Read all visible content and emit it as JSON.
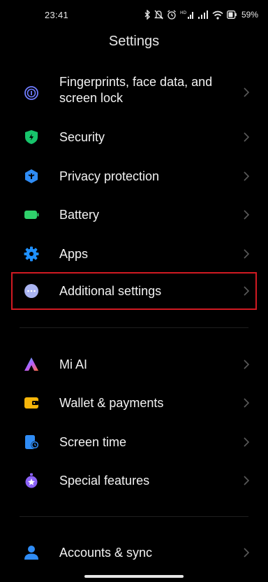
{
  "status_bar": {
    "time": "23:41",
    "battery_percent": "59%",
    "icons": [
      "bluetooth-icon",
      "mute-icon",
      "alarm-icon",
      "hd-signal-icon",
      "signal-icon",
      "wifi-icon",
      "battery-icon"
    ]
  },
  "page": {
    "title": "Settings"
  },
  "settings_group_1": [
    {
      "label": "Fingerprints, face data, and screen lock",
      "icon": "fingerprint-icon",
      "color": "#6f7cff"
    },
    {
      "label": "Security",
      "icon": "security-shield-icon",
      "color": "#17c46b"
    },
    {
      "label": "Privacy protection",
      "icon": "privacy-icon",
      "color": "#2f8cf5"
    },
    {
      "label": "Battery",
      "icon": "battery-icon",
      "color": "#2fd16b"
    },
    {
      "label": "Apps",
      "icon": "gear-icon",
      "color": "#1e90ff"
    },
    {
      "label": "Additional settings",
      "icon": "more-dots-icon",
      "color": "#aab4f2"
    }
  ],
  "settings_group_2": [
    {
      "label": "Mi AI",
      "icon": "mi-ai-icon"
    },
    {
      "label": "Wallet & payments",
      "icon": "wallet-icon",
      "color": "#f5b50a"
    },
    {
      "label": "Screen time",
      "icon": "screen-time-icon",
      "color": "#2f8cf5"
    },
    {
      "label": "Special features",
      "icon": "special-features-icon",
      "color": "#8b62f7"
    }
  ],
  "settings_group_3": [
    {
      "label": "Accounts & sync",
      "icon": "account-icon",
      "color": "#2f8cf5"
    }
  ],
  "colors": {
    "highlight_border": "#d11a22",
    "background": "#000000",
    "chevron": "#5a5a5a"
  }
}
